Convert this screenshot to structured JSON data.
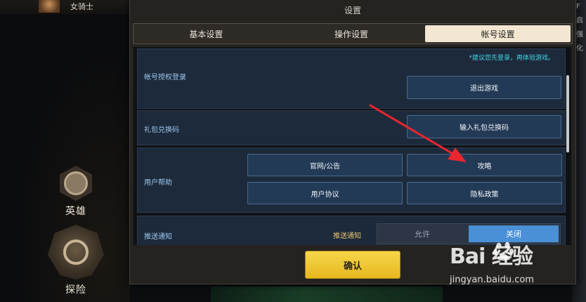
{
  "hud": {
    "player_name": "女骑士",
    "right_edge_text": "F启 强化",
    "nav_hero_label": "英雄",
    "nav_explore_label": "探险"
  },
  "dialog": {
    "title": "设置",
    "tabs": [
      {
        "label": "基本设置",
        "active": false
      },
      {
        "label": "操作设置",
        "active": false
      },
      {
        "label": "帐号设置",
        "active": true
      }
    ],
    "account_login": {
      "label": "帐号授权登录",
      "hint": "*建议您先登录，再体验游戏。",
      "logout_button": "退出游戏"
    },
    "gift_code": {
      "label": "礼包兑换码",
      "input_button": "输入礼包兑换码"
    },
    "user_help": {
      "label": "用户帮助",
      "official_button": "官网/公告",
      "guide_button": "攻略",
      "agreement_button": "用户协议",
      "privacy_button": "隐私政策"
    },
    "push": {
      "label": "推送通知",
      "inline_label": "推送通知",
      "allow": "允许",
      "off": "关闭",
      "selected": "关闭"
    },
    "confirm_button": "确认"
  },
  "watermark": {
    "brand": "Bai 经验",
    "url": "jingyan.baidu.com"
  },
  "colors": {
    "confirm": "#f2cc35",
    "toggle_on": "#4a90d6",
    "hint": "#3fd7e6",
    "arrow": "#e8262e"
  }
}
